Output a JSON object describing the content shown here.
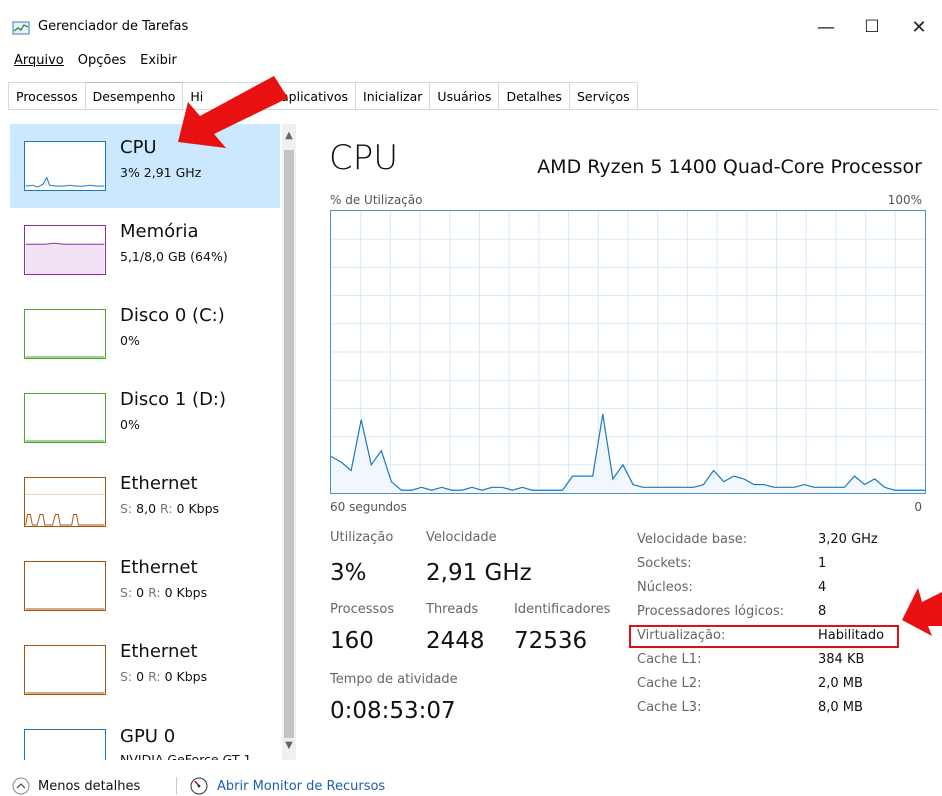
{
  "window": {
    "title": "Gerenciador de Tarefas",
    "controls": {
      "minimize": "—",
      "maximize": "☐",
      "close": "✕"
    }
  },
  "menu": [
    "Arquivo",
    "Opções",
    "Exibir"
  ],
  "tabs": [
    "Processos",
    "Desempenho",
    "Hi",
    "de aplicativos",
    "Inicializar",
    "Usuários",
    "Detalhes",
    "Serviços"
  ],
  "sidebar": {
    "items": [
      {
        "title": "CPU",
        "sub": "3% 2,91 GHz",
        "color": "#1a78c2",
        "selected": true
      },
      {
        "title": "Memória",
        "sub": "5,1/8,0 GB (64%)",
        "color": "#8b2fa0"
      },
      {
        "title": "Disco 0 (C:)",
        "sub": "0%",
        "color": "#4aa32b"
      },
      {
        "title": "Disco 1 (D:)",
        "sub": "0%",
        "color": "#4aa32b"
      },
      {
        "title": "Ethernet",
        "sub_label1": "S:",
        "sub_val1": "8,0",
        "sub_label2": "R:",
        "sub_val2": "0 Kbps",
        "color": "#a8540f"
      },
      {
        "title": "Ethernet",
        "sub_label1": "S:",
        "sub_val1": "0",
        "sub_label2": "R:",
        "sub_val2": "0 Kbps",
        "color": "#a8540f"
      },
      {
        "title": "Ethernet",
        "sub_label1": "S:",
        "sub_val1": "0",
        "sub_label2": "R:",
        "sub_val2": "0 Kbps",
        "color": "#a8540f"
      },
      {
        "title": "GPU 0",
        "sub": "NVIDIA GeForce GT 1",
        "color": "#1a78c2"
      }
    ]
  },
  "main": {
    "title": "CPU",
    "model": "AMD Ryzen 5 1400 Quad-Core Processor",
    "graph_label_left": "% de Utilização",
    "graph_label_right": "100%",
    "time_label_left": "60 segundos",
    "time_label_right": "0",
    "graph_series": [
      13,
      11,
      8,
      26,
      10,
      15,
      4,
      1,
      1,
      2,
      1,
      2,
      1,
      1,
      2,
      1,
      2,
      2,
      1,
      2,
      1,
      1,
      1,
      1,
      6,
      6,
      6,
      28,
      5,
      10,
      3,
      2,
      2,
      2,
      2,
      2,
      2,
      3,
      8,
      4,
      6,
      5,
      3,
      3,
      2,
      2,
      2,
      3,
      2,
      2,
      2,
      2,
      6,
      3,
      5,
      2,
      1,
      1,
      1,
      1
    ]
  },
  "stats": {
    "utilizacao_label": "Utilização",
    "utilizacao": "3%",
    "velocidade_label": "Velocidade",
    "velocidade": "2,91 GHz",
    "processos_label": "Processos",
    "processos": "160",
    "threads_label": "Threads",
    "threads": "2448",
    "identificadores_label": "Identificadores",
    "identificadores": "72536",
    "tempo_label": "Tempo de atividade",
    "tempo": "0:08:53:07"
  },
  "details": [
    {
      "label": "Velocidade base:",
      "value": "3,20 GHz"
    },
    {
      "label": "Sockets:",
      "value": "1"
    },
    {
      "label": "Núcleos:",
      "value": "4"
    },
    {
      "label": "Processadores lógicos:",
      "value": "8"
    },
    {
      "label": "Virtualização:",
      "value": "Habilitado"
    },
    {
      "label": "Cache L1:",
      "value": "384 KB"
    },
    {
      "label": "Cache L2:",
      "value": "2,0 MB"
    },
    {
      "label": "Cache L3:",
      "value": "8,0 MB"
    }
  ],
  "footer": {
    "less_details": "Menos detalhes",
    "open_monitor": "Abrir Monitor de Recursos"
  },
  "accent_colors": {
    "selection": "#cce8ff",
    "graph": "#4a90c8",
    "highlight": "#e0101a",
    "arrow": "#e81010",
    "link": "#1a5fb4"
  }
}
